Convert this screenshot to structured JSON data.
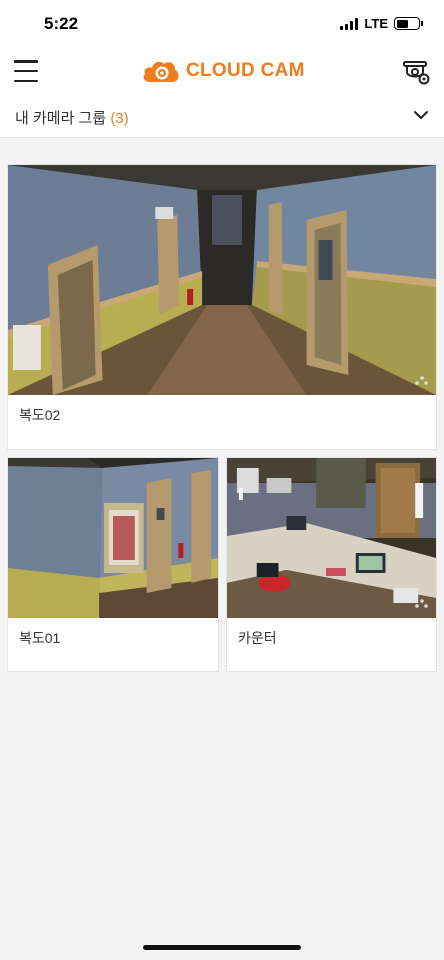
{
  "status": {
    "time": "5:22",
    "network": "LTE"
  },
  "header": {
    "logo_text": "CLOUD CAM",
    "brand_color": "#f07c1e"
  },
  "group": {
    "title": "내 카메라 그룹",
    "count": "(3)"
  },
  "cameras": [
    {
      "name": "복도02",
      "scene": "hallway-wide"
    },
    {
      "name": "복도01",
      "scene": "hallway-corner"
    },
    {
      "name": "카운터",
      "scene": "counter-desk"
    }
  ],
  "icons": {
    "menu": "hamburger-menu-icon",
    "settings": "camera-settings-icon",
    "dropdown": "chevron-down-icon",
    "more": "more-dots-icon"
  }
}
